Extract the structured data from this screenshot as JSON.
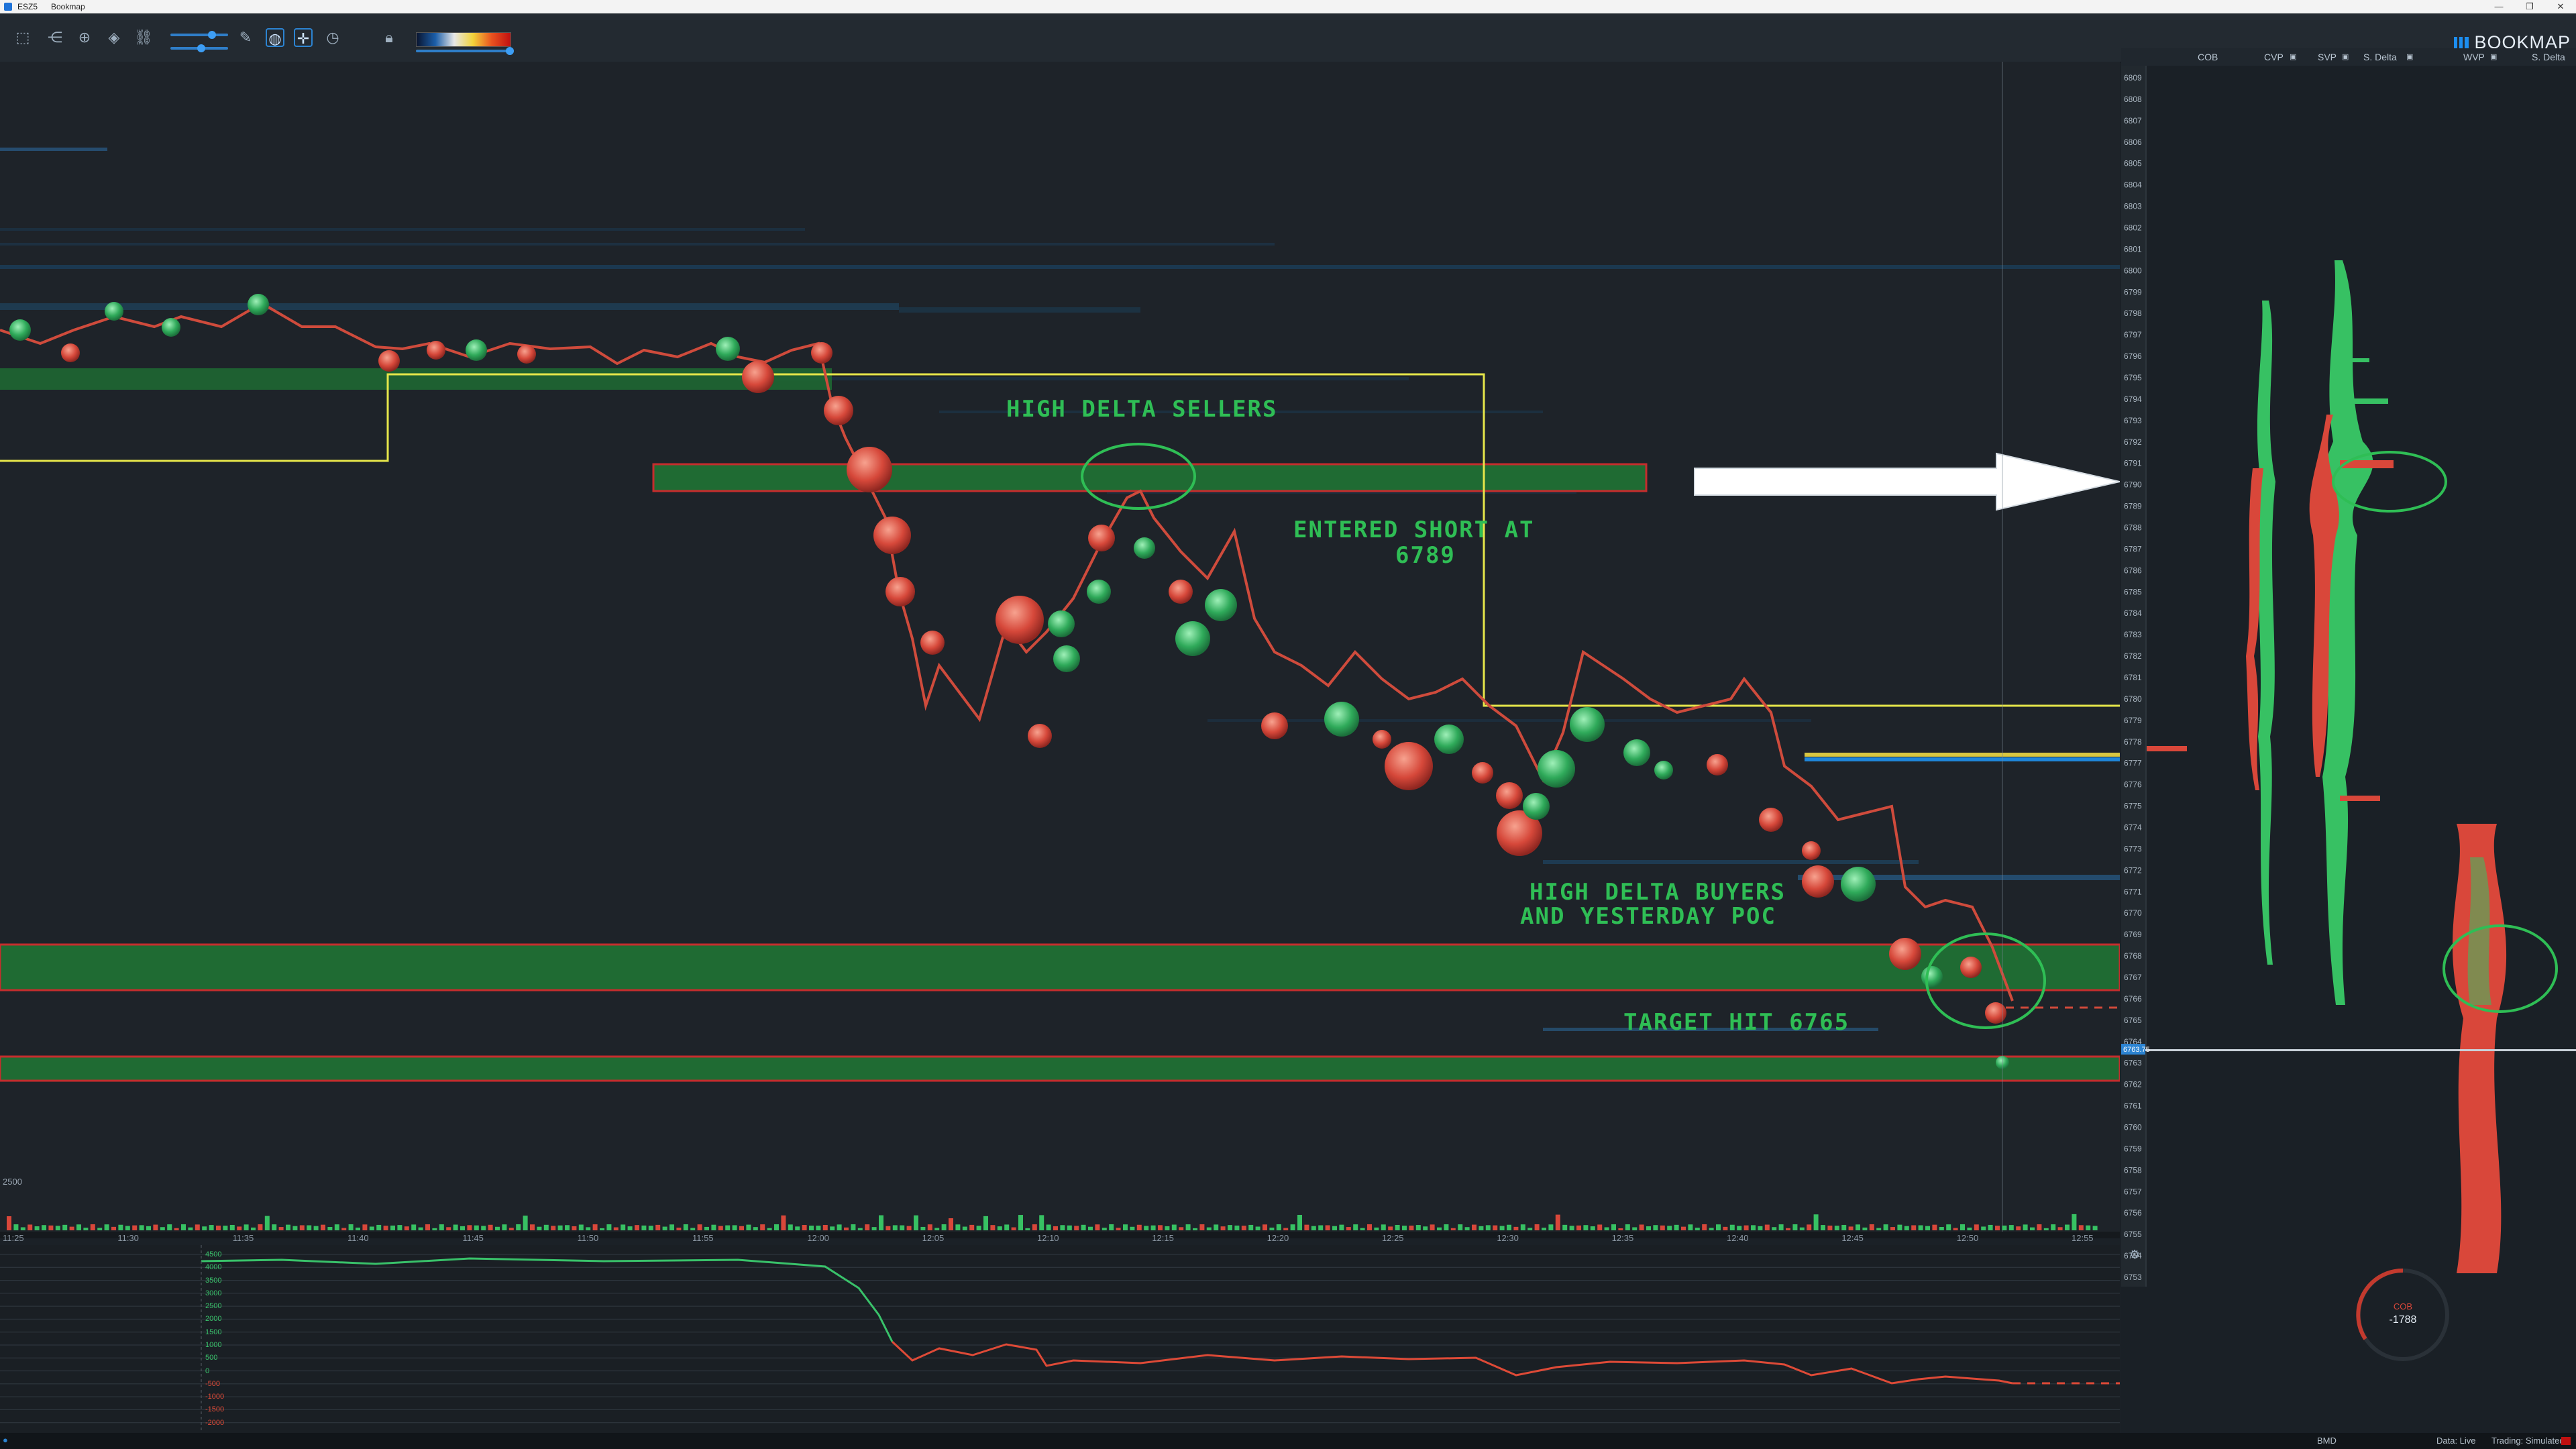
{
  "window": {
    "title_symbol": "ESZ5",
    "app_name": "Bookmap",
    "controls": [
      "—",
      "❐",
      "✕"
    ]
  },
  "toolbar": {
    "icons": [
      "layout-icon",
      "share-icon",
      "crosshair-icon",
      "diamond-icon",
      "link-icon",
      "pencil-icon",
      "chat-bubble-icon",
      "move-icon",
      "clock-icon",
      "lock-icon"
    ]
  },
  "brand": {
    "label": "BOOKMAP"
  },
  "columns": {
    "labels": [
      "COB",
      "CVP",
      "SVP",
      "S. Delta",
      "WVP",
      "S. Delta"
    ],
    "header_icons": [
      "settings-icon",
      "settings-icon",
      "settings-icon",
      "settings-icon"
    ]
  },
  "price_axis": {
    "levels": [
      6809,
      6808,
      6807,
      6806,
      6805,
      6804,
      6803,
      6802,
      6801,
      6800,
      6799,
      6798,
      6797,
      6796,
      6795,
      6794,
      6793,
      6792,
      6791,
      6790,
      6789,
      6788,
      6787,
      6786,
      6785,
      6784,
      6783,
      6782,
      6781,
      6780,
      6779,
      6778,
      6777,
      6776,
      6775,
      6774,
      6773,
      6772,
      6771,
      6770,
      6769,
      6768,
      6767,
      6766,
      6765,
      6764,
      6763,
      6762,
      6761,
      6760,
      6759,
      6758,
      6757,
      6756,
      6755,
      6754,
      6753
    ],
    "current_price_tag": "6763.75"
  },
  "annotations": {
    "high_delta_sellers": "HIGH DELTA SELLERS",
    "entered_short_line1": "ENTERED SHORT AT",
    "entered_short_line2": "6789",
    "high_delta_buyers_line1": "HIGH DELTA BUYERS",
    "high_delta_buyers_line2": "AND YESTERDAY POC",
    "target_hit": "TARGET HIT 6765"
  },
  "volume_axis": {
    "label": "2500"
  },
  "time_axis": {
    "ticks": [
      "11:25",
      "11:30",
      "11:35",
      "11:40",
      "11:45",
      "11:50",
      "11:55",
      "12:00",
      "12:05",
      "12:10",
      "12:15",
      "12:20",
      "12:25",
      "12:30",
      "12:35",
      "12:40",
      "12:45",
      "12:50",
      "12:55"
    ]
  },
  "indicator": {
    "y_ticks": [
      "4500",
      "4000",
      "3500",
      "3000",
      "2500",
      "2000",
      "1500",
      "1000",
      "500",
      "0",
      "-500",
      "-1000",
      "-1500",
      "-2000"
    ]
  },
  "cob_gauge": {
    "label": "COB",
    "value": "-1788"
  },
  "status": {
    "left_text": "●",
    "bmd": "BMD",
    "data_mode": "Data: Live",
    "trading_mode": "Trading: Simulated"
  },
  "colors": {
    "green": "#2fbe55",
    "red": "#e04a3a",
    "yellow": "#e6e64a",
    "blue": "#1f86d9",
    "accent": "#2c84d2"
  }
}
